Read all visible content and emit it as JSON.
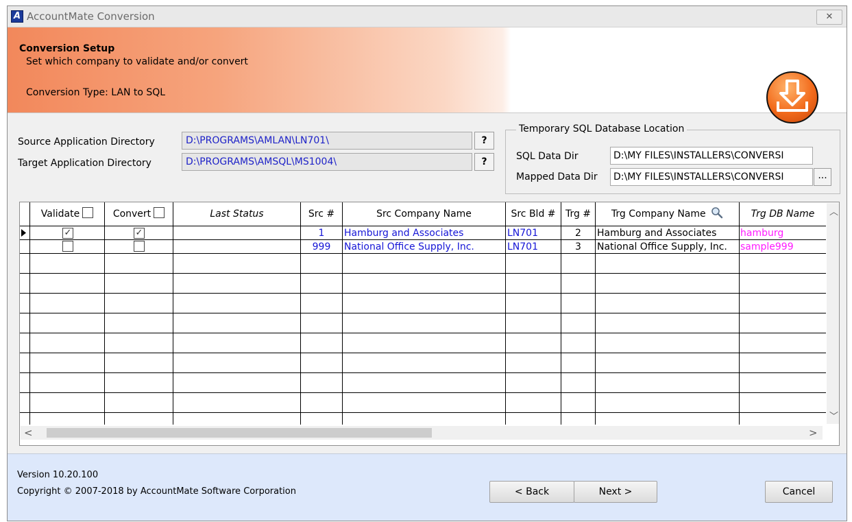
{
  "window": {
    "title": "AccountMate Conversion",
    "logo_letter": "A",
    "close_glyph": "✕"
  },
  "banner": {
    "title": "Conversion Setup",
    "subtitle": "Set which company to validate and/or convert",
    "conversion_type": "Conversion Type: LAN to SQL",
    "icon": "download-icon"
  },
  "dirs": {
    "source_label": "Source Application Directory",
    "source_value": "D:\\PROGRAMS\\AMLAN\\LN701\\",
    "target_label": "Target Application Directory",
    "target_value": "D:\\PROGRAMS\\AMSQL\\MS1004\\",
    "help_label": "?"
  },
  "temp_sql": {
    "group_title": "Temporary SQL Database Location",
    "sql_dir_label": "SQL Data Dir",
    "sql_dir_value": "D:\\MY FILES\\INSTALLERS\\CONVERSI",
    "mapped_dir_label": "Mapped Data Dir",
    "mapped_dir_value": "D:\\MY FILES\\INSTALLERS\\CONVERSI",
    "browse_label": "..."
  },
  "grid": {
    "columns": {
      "validate": "Validate",
      "convert": "Convert",
      "last_status": "Last Status",
      "src_no": "Src #",
      "src_company": "Src Company Name",
      "src_bld": "Src Bld #",
      "trg_no": "Trg #",
      "trg_company": "Trg Company Name",
      "trg_db": "Trg DB Name"
    },
    "rows": [
      {
        "validate": true,
        "convert": true,
        "last_status": "",
        "src_no": "1",
        "src_company": "Hamburg and Associates",
        "src_bld": "LN701",
        "trg_no": "2",
        "trg_company": "Hamburg and Associates",
        "trg_db": "hamburg"
      },
      {
        "validate": false,
        "convert": false,
        "last_status": "",
        "src_no": "999",
        "src_company": "National Office Supply, Inc.",
        "src_bld": "LN701",
        "trg_no": "3",
        "trg_company": "National Office Supply, Inc.",
        "trg_db": "sample999"
      }
    ],
    "colors": {
      "blue_text": "#1515d6",
      "magenta_text": "#ff19ff"
    }
  },
  "footer": {
    "version": "Version 10.20.100",
    "copyright": "Copyright © 2007-2018 by AccountMate Software Corporation",
    "back_label": "< Back",
    "next_label": "Next >",
    "cancel_label": "Cancel"
  }
}
